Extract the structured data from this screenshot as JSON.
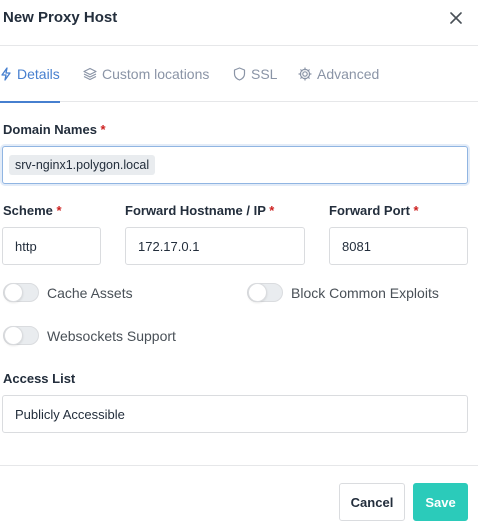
{
  "dialog": {
    "title": "New Proxy Host",
    "close_icon": "close-icon"
  },
  "tabs": [
    {
      "label": "Details",
      "icon": "bolt-icon",
      "active": true
    },
    {
      "label": "Custom locations",
      "icon": "layers-icon",
      "active": false
    },
    {
      "label": "SSL",
      "icon": "shield-icon",
      "active": false
    },
    {
      "label": "Advanced",
      "icon": "gear-icon",
      "active": false
    }
  ],
  "form": {
    "domain_names": {
      "label": "Domain Names",
      "required": "*",
      "values": [
        "srv-nginx1.polygon.local"
      ]
    },
    "scheme": {
      "label": "Scheme",
      "required": "*",
      "value": "http"
    },
    "forward_hostname": {
      "label": "Forward Hostname / IP",
      "required": "*",
      "value": "172.17.0.1"
    },
    "forward_port": {
      "label": "Forward Port",
      "required": "*",
      "value": "8081"
    },
    "toggles": {
      "cache_assets": {
        "label": "Cache Assets",
        "on": false
      },
      "block_exploits": {
        "label": "Block Common Exploits",
        "on": false
      },
      "websockets": {
        "label": "Websockets Support",
        "on": false
      }
    },
    "access_list": {
      "label": "Access List",
      "value": "Publicly Accessible"
    }
  },
  "footer": {
    "cancel_label": "Cancel",
    "save_label": "Save"
  },
  "colors": {
    "accent": "#467fcf",
    "save": "#2bcbba",
    "required": "#cd201f"
  }
}
